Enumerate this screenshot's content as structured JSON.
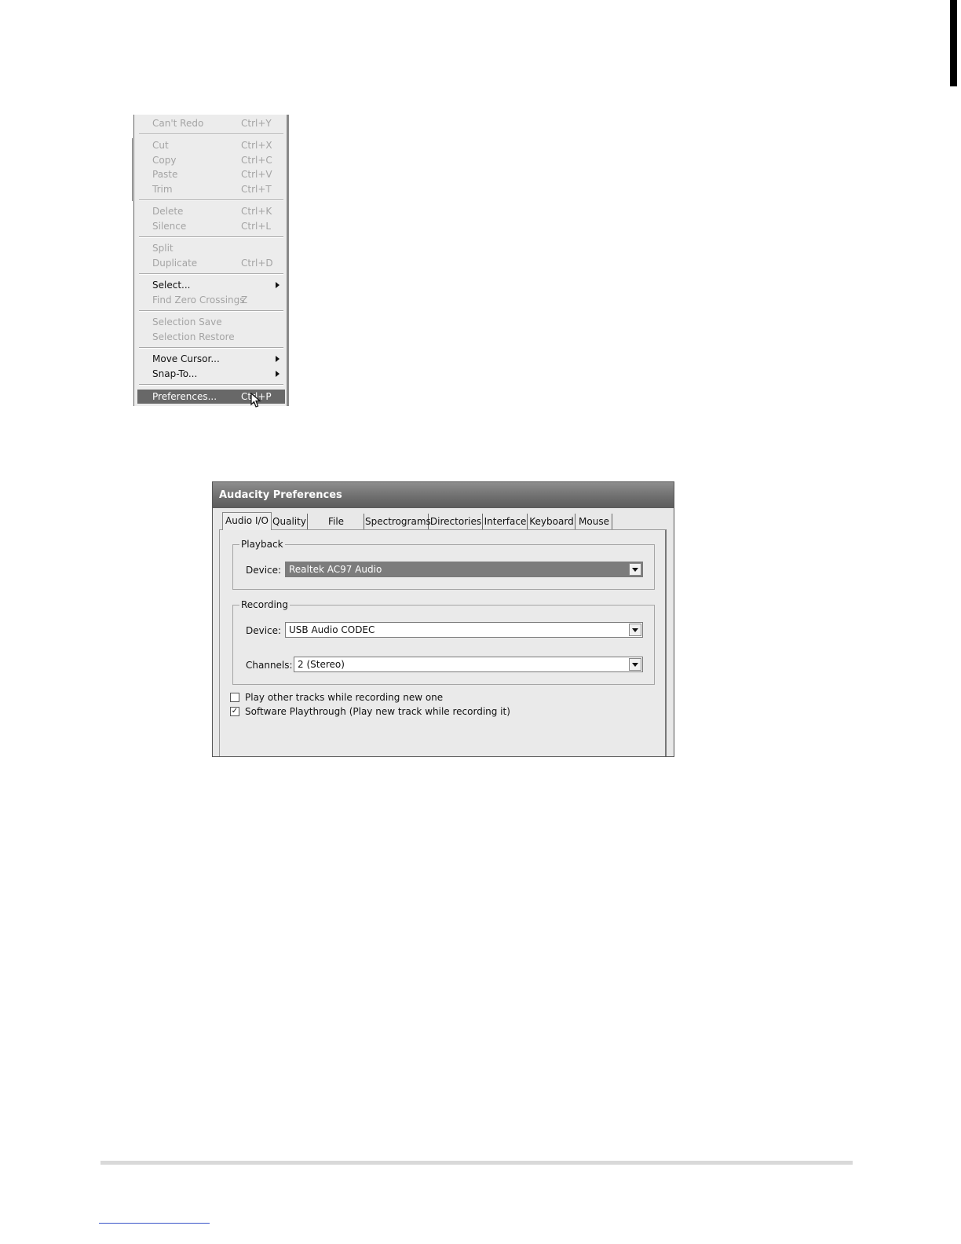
{
  "edit_menu": {
    "items": [
      {
        "label": "Can't Redo",
        "shortcut": "Ctrl+Y",
        "enabled": false
      },
      {
        "label": "Cut",
        "shortcut": "Ctrl+X",
        "enabled": false
      },
      {
        "label": "Copy",
        "shortcut": "Ctrl+C",
        "enabled": false
      },
      {
        "label": "Paste",
        "shortcut": "Ctrl+V",
        "enabled": false
      },
      {
        "label": "Trim",
        "shortcut": "Ctrl+T",
        "enabled": false
      },
      {
        "label": "Delete",
        "shortcut": "Ctrl+K",
        "enabled": false
      },
      {
        "label": "Silence",
        "shortcut": "Ctrl+L",
        "enabled": false
      },
      {
        "label": "Split",
        "shortcut": "",
        "enabled": false
      },
      {
        "label": "Duplicate",
        "shortcut": "Ctrl+D",
        "enabled": false
      },
      {
        "label": "Select...",
        "shortcut": "",
        "enabled": true,
        "submenu": true
      },
      {
        "label": "Find Zero Crossings",
        "shortcut": "Z",
        "enabled": false
      },
      {
        "label": "Selection Save",
        "shortcut": "",
        "enabled": false
      },
      {
        "label": "Selection Restore",
        "shortcut": "",
        "enabled": false
      },
      {
        "label": "Move Cursor...",
        "shortcut": "",
        "enabled": true,
        "submenu": true
      },
      {
        "label": "Snap-To...",
        "shortcut": "",
        "enabled": true,
        "submenu": true
      },
      {
        "label": "Preferences...",
        "shortcut": "Ctrl+P",
        "enabled": true,
        "highlighted": true
      }
    ]
  },
  "dialog": {
    "title": "Audacity Preferences",
    "tabs": [
      "Audio I/O",
      "Quality",
      "File Formats",
      "Spectrograms",
      "Directories",
      "Interface",
      "Keyboard",
      "Mouse"
    ],
    "active_tab": "Audio I/O",
    "playback": {
      "group_label": "Playback",
      "device_label": "Device:",
      "device_value": "Realtek AC97 Audio"
    },
    "recording": {
      "group_label": "Recording",
      "device_label": "Device:",
      "device_value": "USB Audio CODEC",
      "channels_label": "Channels:",
      "channels_value": "2 (Stereo)"
    },
    "options": [
      {
        "label": "Play other tracks while recording new one",
        "checked": false
      },
      {
        "label": "Software Playthrough (Play new track while recording it)",
        "checked": true
      }
    ]
  },
  "colors": {
    "menu_highlight": "#686868",
    "disabled_text": "#a4a4a4",
    "titlebar": "#6f6f6f"
  }
}
